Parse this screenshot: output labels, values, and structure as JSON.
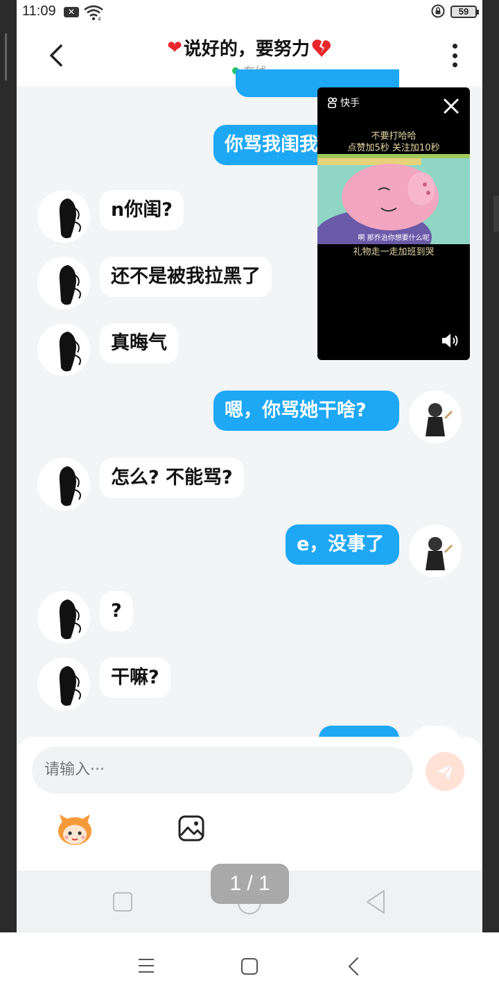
{
  "status_bar": {
    "time": "11:09",
    "notification_icon": "x-notification-icon",
    "wifi_icon": "wifi-icon",
    "lock_icon": "rotation-lock-icon",
    "battery": "59"
  },
  "header": {
    "title": "说好的，要努力",
    "left_emoji": "❤",
    "right_emoji": "💔",
    "online_status": "在线",
    "back_icon": "back-arrow-icon",
    "more_icon": "more-vertical-icon"
  },
  "messages": [
    {
      "side": "out",
      "text": "你骂我闺我"
    },
    {
      "side": "in",
      "text": "n你闺?"
    },
    {
      "side": "in",
      "text": "还不是被我拉黑了"
    },
    {
      "side": "in",
      "text": "真晦气"
    },
    {
      "side": "out",
      "text": "嗯，你骂她干啥?"
    },
    {
      "side": "in",
      "text": "怎么? 不能骂?"
    },
    {
      "side": "out",
      "text": "e，没事了"
    },
    {
      "side": "in",
      "text": "?"
    },
    {
      "side": "in",
      "text": "干嘛?"
    }
  ],
  "video_popup": {
    "brand": "快手",
    "caption_top_1": "不要打哈哈",
    "caption_top_2": "点赞加5秒 关注加10秒",
    "subtitle": "啊 那乔治你想要什么呢",
    "caption_bottom": "礼物走一走加班到哭",
    "close_icon": "close-icon",
    "volume_icon": "volume-icon"
  },
  "input_panel": {
    "placeholder": "请输入···",
    "send_icon": "send-icon",
    "emoji_icon": "cartoon-emoji-icon",
    "image_icon": "image-icon"
  },
  "pager": "1 / 1",
  "colors": {
    "accent_blue": "#1ea7f5",
    "online_green": "#22c55e",
    "heart_red": "#e8262b",
    "chat_bg": "#f3f4f6"
  }
}
